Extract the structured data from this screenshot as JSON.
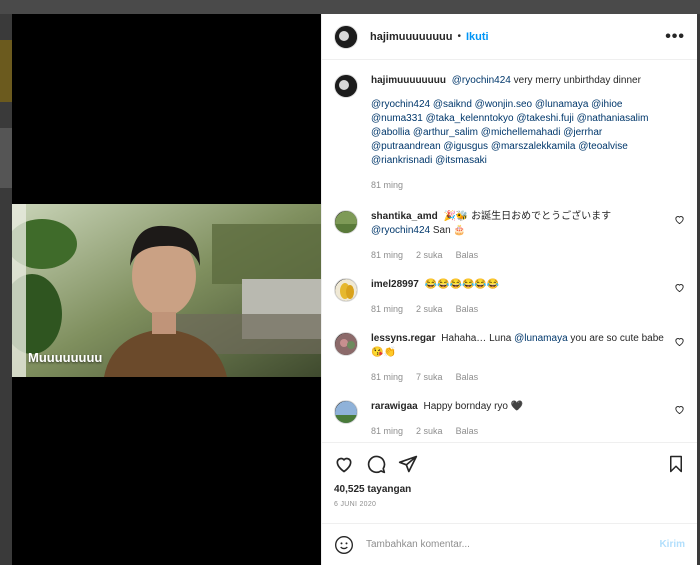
{
  "media": {
    "overlay_text": "Muuuuuuuu"
  },
  "header": {
    "username": "hajimuuuuuuuu",
    "separator": "•",
    "follow_label": "Ikuti",
    "more_label": "•••"
  },
  "caption": {
    "username": "hajimuuuuuuuu",
    "mention": "@ryochin424",
    "text": " very merry unbirthday dinner",
    "tags": "@ryochin424 @saiknd @wonjin.seo @lunamaya @ihioe @numa331 @taka_kelenntokyo @takeshi.fuji @nathaniasalim @abollia @arthur_salim @michellemahadi @jerrhar @putraandrean @igusgus @marszalekkamila @teoalvise @riankrisnadi @itsmasaki",
    "time": "81 ming"
  },
  "comments": [
    {
      "username": "shantika_amd",
      "text": "🎉🐝 お誕生日おめでとうございます",
      "mention": "@ryochin424",
      "text2": " San 🎂",
      "time": "81 ming",
      "likes": "2 suka",
      "reply": "Balas"
    },
    {
      "username": "imel28997",
      "text": "😂😂😂😂😂😂",
      "mention": "",
      "text2": "",
      "time": "81 ming",
      "likes": "2 suka",
      "reply": "Balas"
    },
    {
      "username": "lessyns.regar",
      "text": "Hahaha… Luna ",
      "mention": "@lunamaya",
      "text2": " you are so cute babe 😘👏",
      "time": "81 ming",
      "likes": "7 suka",
      "reply": "Balas"
    },
    {
      "username": "rarawigaa",
      "text": "Happy bornday ryo 🖤",
      "mention": "",
      "text2": "",
      "time": "81 ming",
      "likes": "2 suka",
      "reply": "Balas"
    }
  ],
  "actions": {
    "views": "40,525 tayangan",
    "date": "6 JUNI 2020"
  },
  "compose": {
    "placeholder": "Tambahkan komentar...",
    "post_label": "Kirim"
  }
}
